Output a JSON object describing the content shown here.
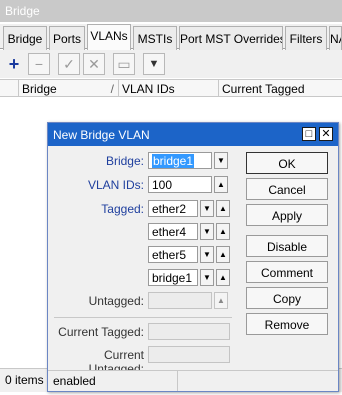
{
  "window": {
    "title": "Bridge"
  },
  "tabs": [
    {
      "label": "Bridge"
    },
    {
      "label": "Ports"
    },
    {
      "label": "VLANs"
    },
    {
      "label": "MSTIs"
    },
    {
      "label": "Port MST Overrides"
    },
    {
      "label": "Filters"
    },
    {
      "label": "NA"
    }
  ],
  "toolbar": {
    "add": "+",
    "remove": "−",
    "enable": "✓",
    "disable": "✕",
    "comment": "▭",
    "filter": "▼"
  },
  "table": {
    "columns": [
      "Bridge",
      "VLAN IDs",
      "Current Tagged"
    ],
    "sort_indicator": "/"
  },
  "status": {
    "items": "0 items"
  },
  "dialog": {
    "title": "New Bridge VLAN",
    "bridge_label": "Bridge:",
    "bridge_value": "bridge1",
    "vlan_ids_label": "VLAN IDs:",
    "vlan_ids_value": "100",
    "tagged_label": "Tagged:",
    "tagged": [
      "ether2",
      "ether4",
      "ether5",
      "bridge1"
    ],
    "untagged_label": "Untagged:",
    "untagged_value": "",
    "current_tagged_label": "Current Tagged:",
    "current_untagged_label": "Current Untagged:",
    "buttons": {
      "ok": "OK",
      "cancel": "Cancel",
      "apply": "Apply",
      "disable": "Disable",
      "comment": "Comment",
      "copy": "Copy",
      "remove": "Remove"
    },
    "status": "enabled"
  },
  "colors": {
    "dialog_title_bg": "#1c64c8",
    "label_blue": "#1f3f9e",
    "selection": "#3399ff",
    "add_icon": "#1a3a9e"
  }
}
